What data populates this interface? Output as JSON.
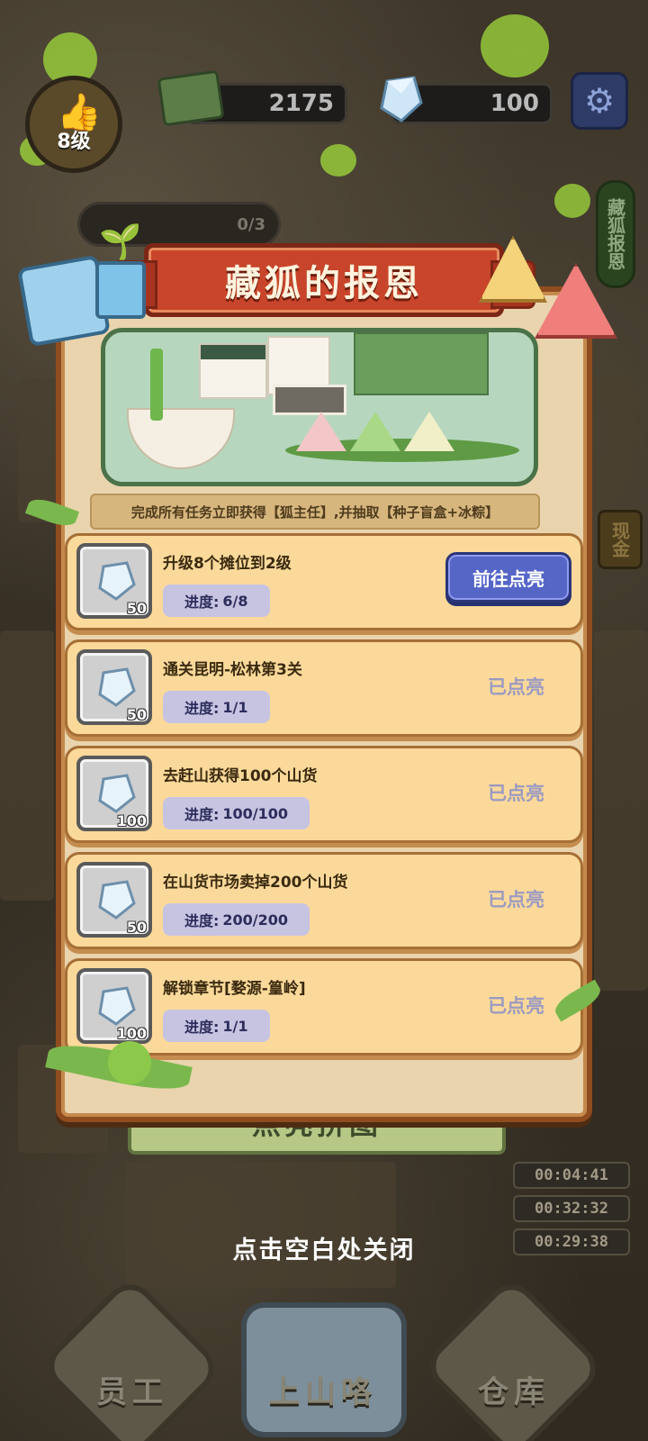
{
  "hud": {
    "level_label": "8级",
    "money": "2175",
    "gems": "100",
    "task_pill_text": "0/3",
    "side_pill_text": "藏狐报恩",
    "cash_tag_text": "现金"
  },
  "panel": {
    "title": "藏狐的报恩",
    "reward_text": "完成所有任务立即获得【狐主任】,并抽取【种子盲盒+冰粽】",
    "tasks": [
      {
        "title": "升级8个摊位到2级",
        "progress_label": "进度:",
        "progress": "6/8",
        "reward_qty": "50",
        "status": "前往点亮"
      },
      {
        "title": "通关昆明-松林第3关",
        "progress_label": "进度:",
        "progress": "1/1",
        "reward_qty": "50",
        "status": "已点亮"
      },
      {
        "title": "去赶山获得100个山货",
        "progress_label": "进度:",
        "progress": "100/100",
        "reward_qty": "100",
        "status": "已点亮"
      },
      {
        "title": "在山货市场卖掉200个山货",
        "progress_label": "进度:",
        "progress": "200/200",
        "reward_qty": "50",
        "status": "已点亮"
      },
      {
        "title": "解锁章节[婺源-篁岭]",
        "progress_label": "进度:",
        "progress": "1/1",
        "reward_qty": "100",
        "status": "已点亮"
      }
    ]
  },
  "background": {
    "puzzle_button": "点亮拼图",
    "timers": [
      "00:04:41",
      "00:32:32",
      "00:29:38"
    ]
  },
  "close_hint": "点击空白处关闭",
  "nav": {
    "staff": "员工",
    "mountain": "上山咯",
    "warehouse": "仓库"
  },
  "colors": {
    "panel_bg": "#e9d4ad",
    "title_red": "#c8452b",
    "task_bg": "#fbd99a",
    "button_blue": "#5566c7",
    "done_text": "#9b9ac2"
  }
}
